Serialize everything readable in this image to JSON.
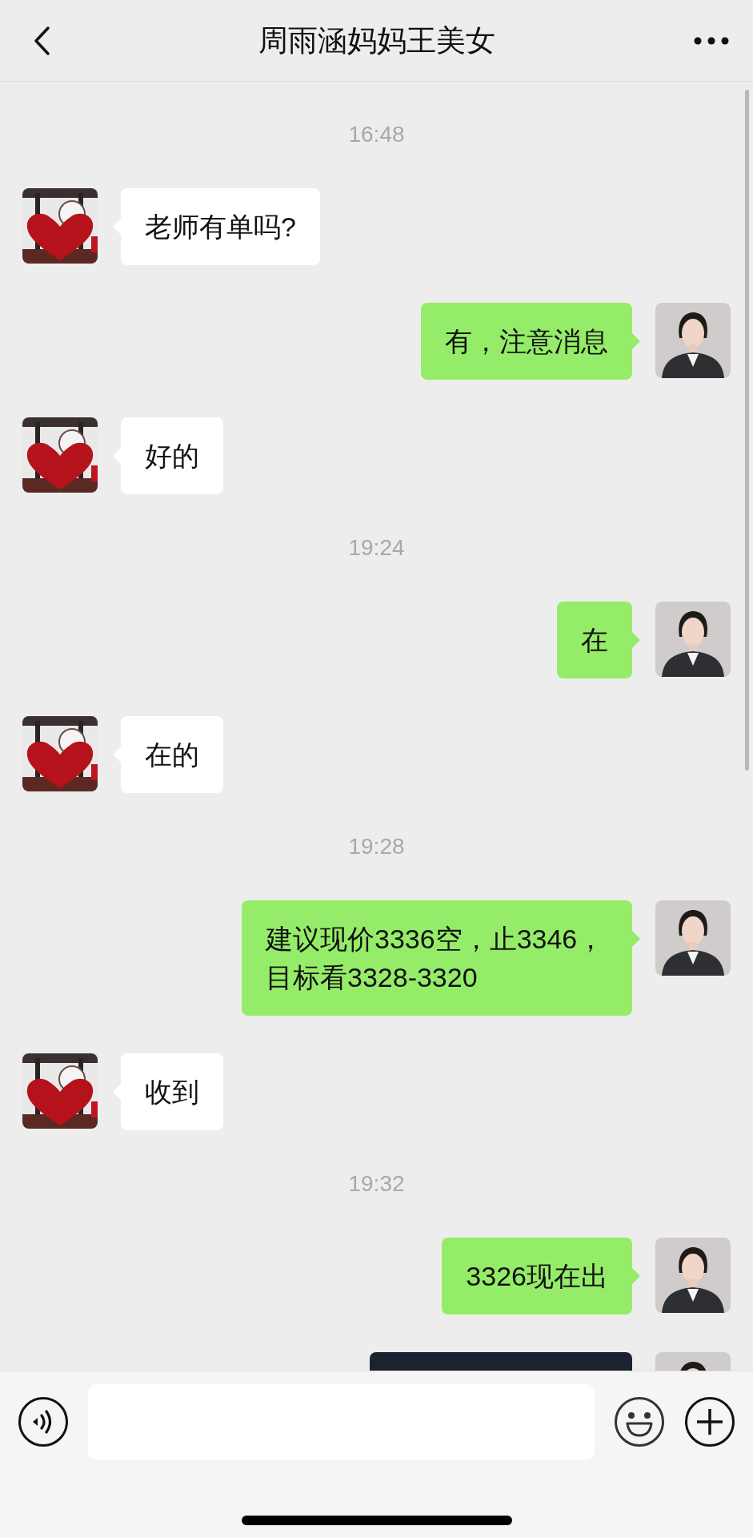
{
  "header": {
    "title": "周雨涵妈妈王美女"
  },
  "messages": [
    {
      "kind": "time",
      "text": "16:48"
    },
    {
      "kind": "received",
      "text": "老师有单吗?"
    },
    {
      "kind": "sent",
      "text": "有，注意消息"
    },
    {
      "kind": "received",
      "text": "好的"
    },
    {
      "kind": "time",
      "text": "19:24"
    },
    {
      "kind": "sent",
      "text": "在"
    },
    {
      "kind": "received",
      "text": "在的"
    },
    {
      "kind": "time",
      "text": "19:28"
    },
    {
      "kind": "sent",
      "text": "建议现价3336空，止3346，目标看3328-3320"
    },
    {
      "kind": "received",
      "text": "收到"
    },
    {
      "kind": "time",
      "text": "19:32"
    },
    {
      "kind": "sent",
      "text": "3326现在出"
    },
    {
      "kind": "sent-card"
    }
  ]
}
